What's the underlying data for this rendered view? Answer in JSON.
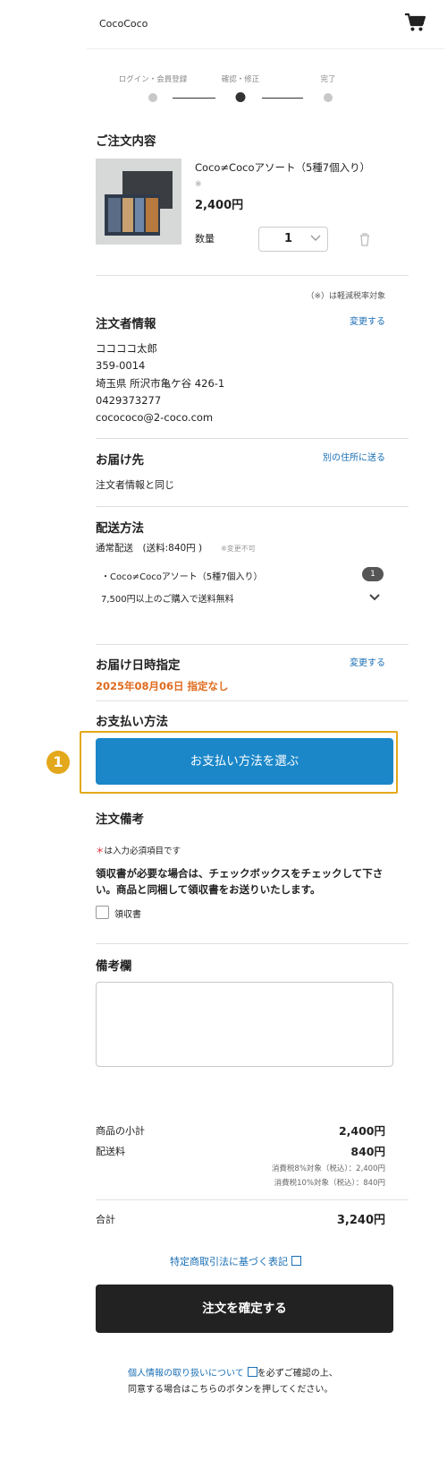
{
  "header": {
    "logo": "CocoCoco",
    "cart_icon": "cart-icon"
  },
  "steps": [
    {
      "label": "ログイン・会員登録"
    },
    {
      "label": "確認・修正"
    },
    {
      "label": "完了"
    }
  ],
  "order": {
    "title": "ご注文内容",
    "product_name": "Coco≠Cocoアソート（5種7個入り）",
    "tax_mark": "※",
    "price": "2,400円",
    "qty_label": "数量",
    "qty_value": "1",
    "tax_note": "（※）は軽減税率対象"
  },
  "orderer": {
    "title": "注文者情報",
    "change": "変更する",
    "name": "ココココ太郎",
    "zip": "359-0014",
    "address": "埼玉県 所沢市亀ケ谷 426-1",
    "phone": "0429373277",
    "email": "cocococo@2-coco.com"
  },
  "delivery": {
    "title": "お届け先",
    "other": "別の住所に送る",
    "value": "注文者情報と同じ"
  },
  "shipping": {
    "title": "配送方法",
    "method": "通常配送　(送料:840円 )",
    "note": "※変更不可",
    "item": "・Coco≠Cocoアソート（5種7個入り）",
    "item_count": "1",
    "free_note": "7,500円以上のご購入で送料無料"
  },
  "datetime": {
    "title": "お届け日時指定",
    "change": "変更する",
    "value": "2025年08月06日 指定なし"
  },
  "payment": {
    "title": "お支払い方法",
    "button": "お支払い方法を選ぶ",
    "marker": "1"
  },
  "remarks": {
    "title": "注文備考",
    "required_mark": "＊",
    "required_note": "は入力必須項目です",
    "receipt_note": "領収書が必要な場合は、チェックボックスをチェックして下さい。商品と同梱して領収書をお送りいたします。",
    "receipt_label": "領収書",
    "memo_title": "備考欄"
  },
  "summary": {
    "subtotal_label": "商品の小計",
    "subtotal": "2,400円",
    "shipping_label": "配送料",
    "shipping": "840円",
    "tax8": "消費税8%対象（税込）：2,400円",
    "tax10": "消費税10%対象（税込）：840円",
    "total_label": "合計",
    "total": "3,240円"
  },
  "footer": {
    "law_link": "特定商取引法に基づく表記",
    "confirm_button": "注文を確定する",
    "privacy_link": "個人情報の取り扱いについて",
    "privacy_rest": "を必ずご確認の上、",
    "privacy_line2": "同意する場合はこちらのボタンを押してください。"
  },
  "colors": {
    "accent": "#1b87c9",
    "highlight": "#e3a81b",
    "date_orange": "#e06a1b"
  }
}
